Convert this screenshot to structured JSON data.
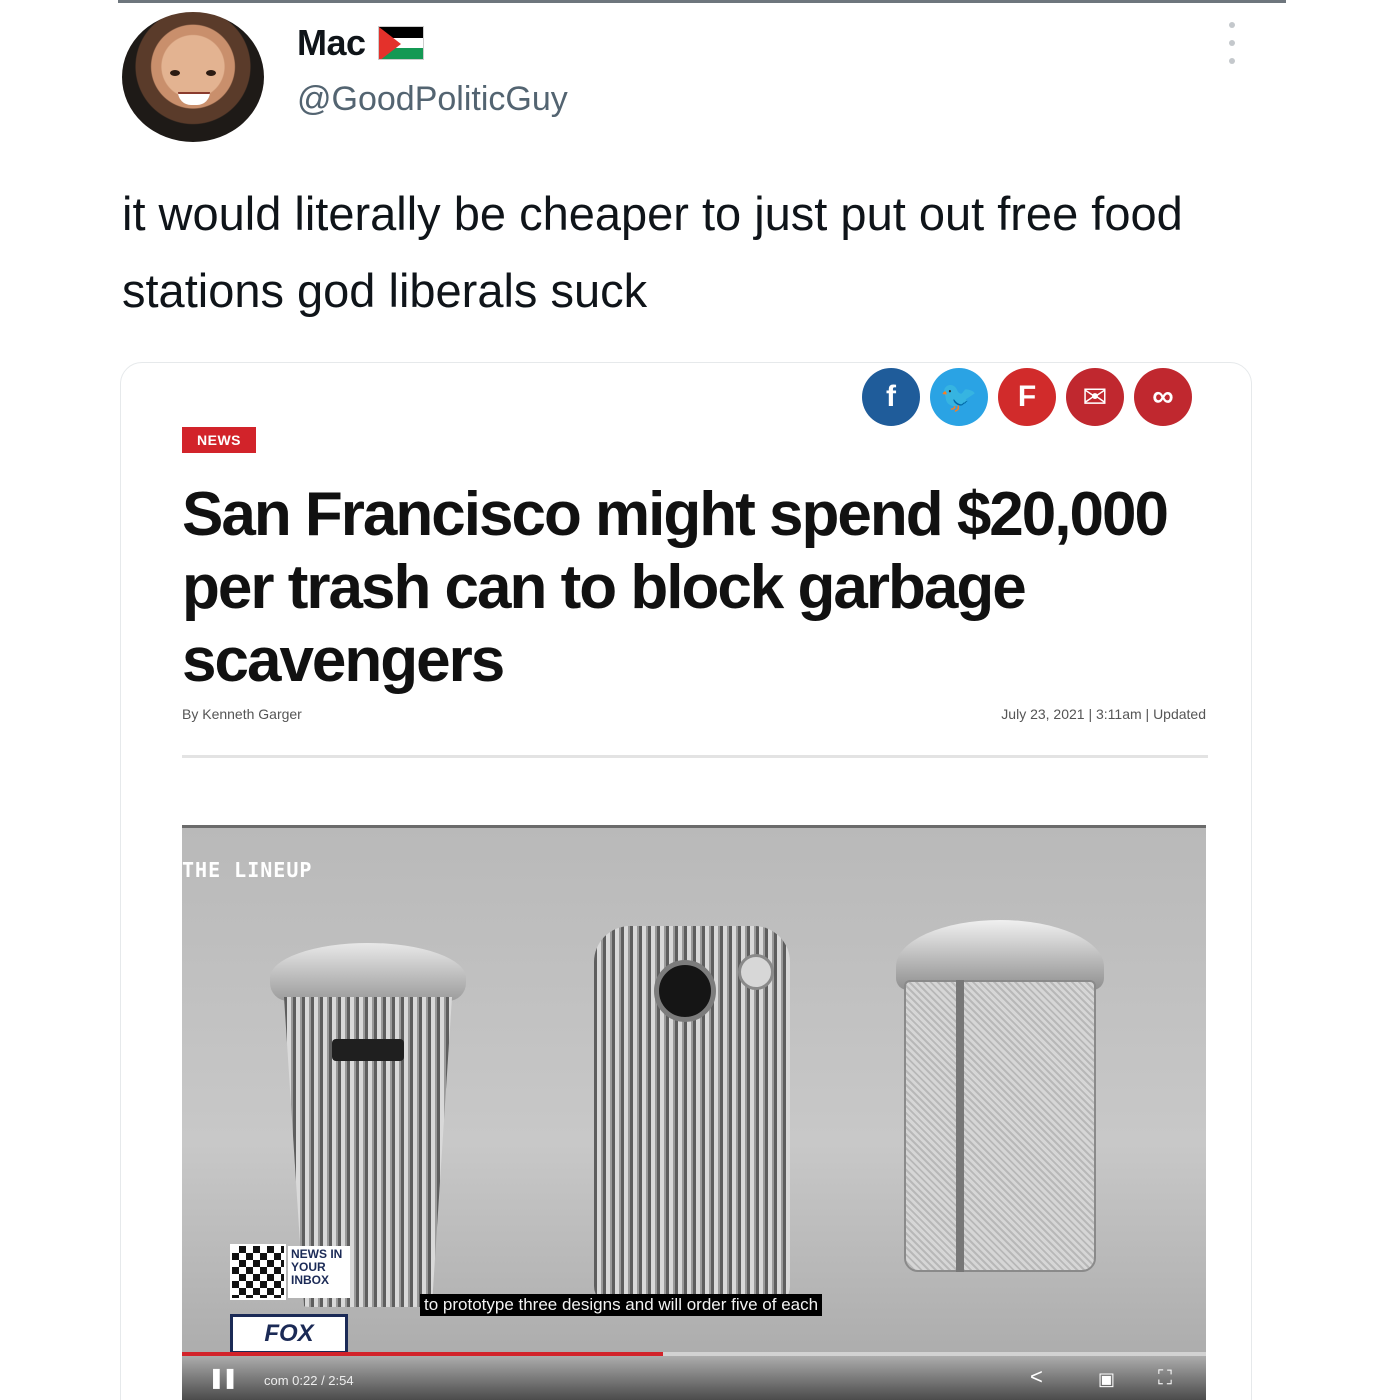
{
  "tweet": {
    "display_name": "Mac",
    "flag_icon": "palestine-flag-icon",
    "handle": "@GoodPoliticGuy",
    "text": "it would literally be cheaper to just put out free food stations god liberals suck"
  },
  "article": {
    "share_icons": [
      {
        "name": "facebook-icon",
        "glyph": "f",
        "color": "#1f5c9a"
      },
      {
        "name": "twitter-icon",
        "glyph": "🐦",
        "color": "#2aa3e4"
      },
      {
        "name": "flipboard-icon",
        "glyph": "F",
        "color": "#d12b2b"
      },
      {
        "name": "email-icon",
        "glyph": "✉",
        "color": "#c0282f"
      },
      {
        "name": "link-icon",
        "glyph": "∞",
        "color": "#c0282f"
      }
    ],
    "section_badge": "NEWS",
    "headline": "San Francisco might spend $20,000 per trash can to block garbage scavengers",
    "byline": "By Kenneth Garger",
    "dateline": "July 23, 2021  |  3:11am  |  Updated"
  },
  "video": {
    "overlay_title": "THE LINEUP",
    "caption": "to prototype three designs and will order five of each",
    "promo_text": "NEWS IN YOUR INBOX",
    "logo_text": "FOX",
    "time": "com 0:22 / 2:54",
    "progress": 0.47
  }
}
